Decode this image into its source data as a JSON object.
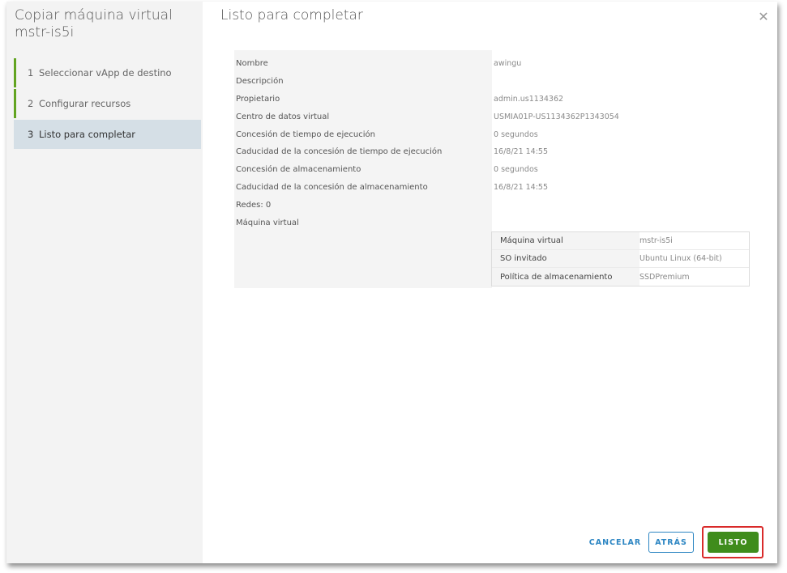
{
  "wizard": {
    "title": "Copiar máquina virtual mstr-is5i",
    "steps": [
      {
        "num": "1",
        "label": "Seleccionar vApp de destino"
      },
      {
        "num": "2",
        "label": "Configurar recursos"
      },
      {
        "num": "3",
        "label": "Listo para completar"
      }
    ],
    "active_step": 3
  },
  "main": {
    "title": "Listo para completar",
    "close_icon": "close-icon"
  },
  "summary": {
    "rows": [
      {
        "key": "Nombre",
        "value": "awingu"
      },
      {
        "key": "Descripción",
        "value": ""
      },
      {
        "key": "Propietario",
        "value": "admin.us1134362"
      },
      {
        "key": "Centro de datos virtual",
        "value": "USMIA01P-US1134362P1343054"
      },
      {
        "key": "Concesión de tiempo de ejecución",
        "value": "0 segundos"
      },
      {
        "key": "Caducidad de la concesión de tiempo de ejecución",
        "value": "16/8/21 14:55"
      },
      {
        "key": "Concesión de almacenamiento",
        "value": "0 segundos"
      },
      {
        "key": "Caducidad de la concesión de almacenamiento",
        "value": "16/8/21 14:55"
      },
      {
        "key": "Redes: 0",
        "value": ""
      },
      {
        "key": "Máquina virtual",
        "value": ""
      }
    ],
    "vm_table": [
      {
        "key": "Máquina virtual",
        "value": "mstr-is5i"
      },
      {
        "key": "SO invitado",
        "value": "Ubuntu Linux (64-bit)"
      },
      {
        "key": "Política de almacenamiento",
        "value": "SSDPremium"
      }
    ]
  },
  "footer": {
    "cancel_label": "CANCELAR",
    "back_label": "ATRÁS",
    "done_label": "LISTO"
  },
  "colors": {
    "accent_green": "#3f8c1c",
    "step_bar": "#62a420",
    "link_blue": "#2d86c3",
    "highlight_red": "#d92a2a"
  }
}
